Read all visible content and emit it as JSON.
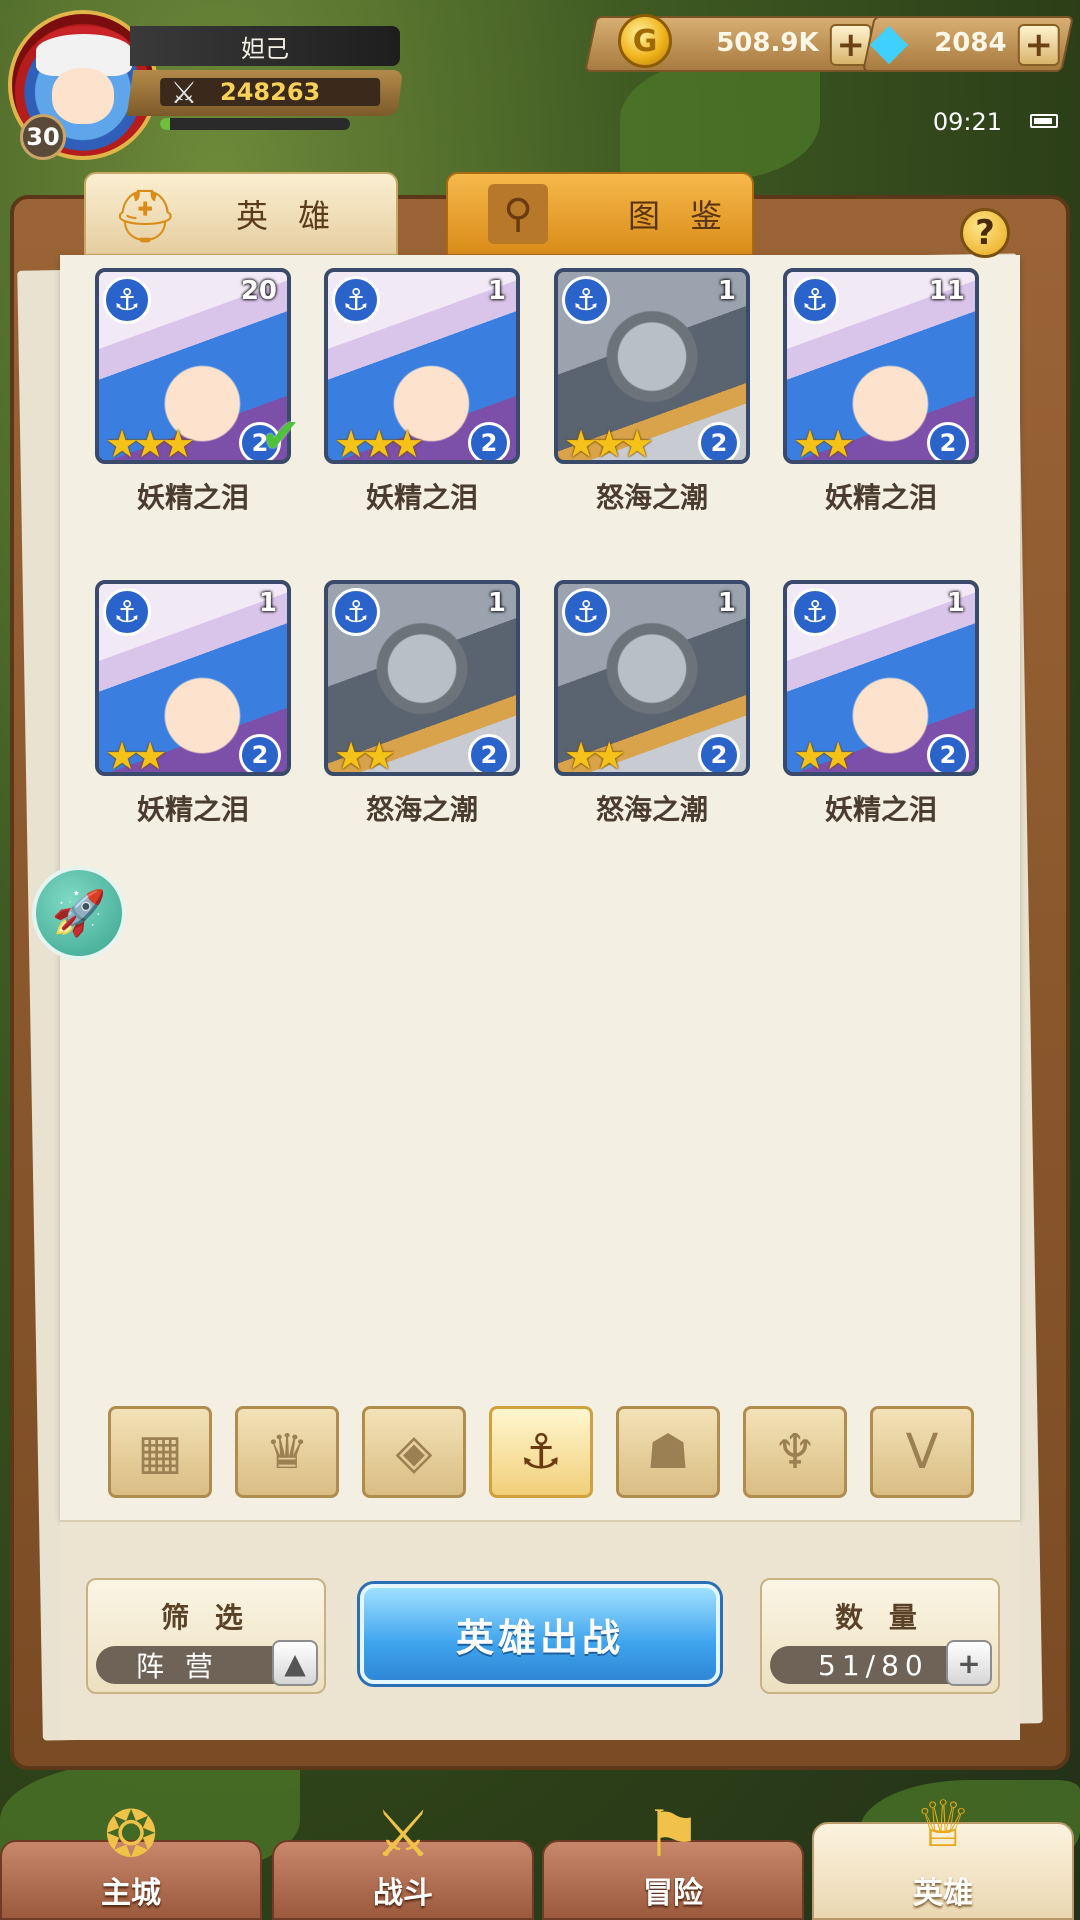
{
  "player": {
    "name": "妲己",
    "level": "30",
    "power": "248263",
    "exp_fraction": 0.05
  },
  "currency": {
    "gold": "508.9K",
    "gems": "2084",
    "plus": "+"
  },
  "status": {
    "time": "09:21"
  },
  "tabs": {
    "heroes": "英 雄",
    "codex": "图 鉴"
  },
  "help": "?",
  "heroes": [
    {
      "name": "妖精之泪",
      "count": "20",
      "stars": 3,
      "tier": "2",
      "type": "fairy",
      "selected": true
    },
    {
      "name": "妖精之泪",
      "count": "1",
      "stars": 3,
      "tier": "2",
      "type": "fairy",
      "selected": false
    },
    {
      "name": "怒海之潮",
      "count": "1",
      "stars": 3,
      "tier": "2",
      "type": "knight",
      "selected": false
    },
    {
      "name": "妖精之泪",
      "count": "11",
      "stars": 2,
      "tier": "2",
      "type": "fairy",
      "selected": false
    },
    {
      "name": "妖精之泪",
      "count": "1",
      "stars": 2,
      "tier": "2",
      "type": "fairy",
      "selected": false
    },
    {
      "name": "怒海之潮",
      "count": "1",
      "stars": 2,
      "tier": "2",
      "type": "knight",
      "selected": false
    },
    {
      "name": "怒海之潮",
      "count": "1",
      "stars": 2,
      "tier": "2",
      "type": "knight",
      "selected": false
    },
    {
      "name": "妖精之泪",
      "count": "1",
      "stars": 2,
      "tier": "2",
      "type": "fairy",
      "selected": false
    }
  ],
  "factions": [
    {
      "icon": "grid-icon",
      "glyph": "▦",
      "active": false
    },
    {
      "icon": "flame-crown-icon",
      "glyph": "♛",
      "active": false
    },
    {
      "icon": "chevron-diamond-icon",
      "glyph": "◈",
      "active": false
    },
    {
      "icon": "anchor-icon",
      "glyph": "⚓",
      "active": true
    },
    {
      "icon": "beast-head-icon",
      "glyph": "☗",
      "active": false
    },
    {
      "icon": "horned-helm-icon",
      "glyph": "♆",
      "active": false
    },
    {
      "icon": "wing-v-icon",
      "glyph": "V",
      "active": false
    }
  ],
  "filter": {
    "title": "筛 选",
    "value": "阵 营",
    "button": "▲"
  },
  "deploy": "英雄出战",
  "quantity": {
    "title": "数 量",
    "value": "51/80",
    "button": "+"
  },
  "nav": [
    {
      "label": "主城",
      "icon": "castle-icon",
      "glyph": "❂",
      "active": false
    },
    {
      "label": "战斗",
      "icon": "crossed-swords-icon",
      "glyph": "⚔",
      "active": false
    },
    {
      "label": "冒险",
      "icon": "map-scroll-icon",
      "glyph": "⚑",
      "active": false
    },
    {
      "label": "英雄",
      "icon": "hero-helmet-icon",
      "glyph": "♕",
      "active": true
    }
  ],
  "colors": {
    "accent_blue": "#3fa4ee",
    "gold_text": "#f7d25b",
    "star": "#f5c21a"
  }
}
